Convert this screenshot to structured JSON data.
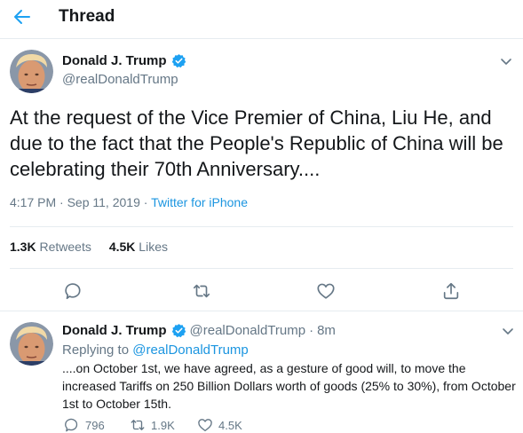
{
  "header": {
    "title": "Thread"
  },
  "main_tweet": {
    "author_name": "Donald J. Trump",
    "author_handle": "@realDonaldTrump",
    "text": "At the request of the Vice Premier of China, Liu He, and due to the fact that the People's Republic of China will be celebrating their 70th Anniversary....",
    "time": "4:17 PM",
    "date": "Sep 11, 2019",
    "separator": " · ",
    "source": "Twitter for iPhone",
    "retweets_count": "1.3K",
    "retweets_label": "Retweets",
    "likes_count": "4.5K",
    "likes_label": "Likes"
  },
  "reply_tweet": {
    "author_name": "Donald J. Trump",
    "author_handle": "@realDonaldTrump",
    "time_ago": "8m",
    "replying_label": "Replying to",
    "replying_to": "@realDonaldTrump",
    "text": "....on October 1st, we have agreed, as a gesture of good will, to move the increased Tariffs on 250 Billion Dollars worth of goods (25% to 30%), from October 1st to October 15th.",
    "action_counts": [
      "796",
      "1.9K",
      "4.5K"
    ]
  },
  "colors": {
    "accent": "#1da1f2",
    "link": "#1b95e0",
    "secondary_text": "#657786",
    "divider": "#e6ecf0"
  },
  "icons": [
    "back-arrow-icon",
    "verified-badge-icon",
    "chevron-down-icon",
    "reply-icon",
    "retweet-icon",
    "like-icon",
    "share-icon"
  ]
}
